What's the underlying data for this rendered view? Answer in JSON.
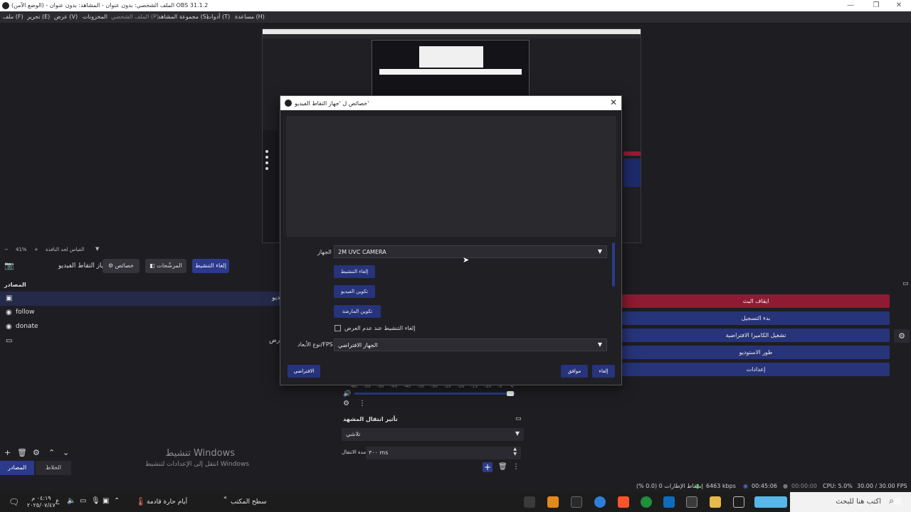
{
  "window": {
    "title": "(الوضع الآمن) - الملف الشخصي: بدون عنوان - المشاهد: بدون عنوان OBS 31.1.2"
  },
  "menu": [
    "ملف (F)",
    "تحرير (E)",
    "عرض (V)",
    "المخزونات",
    "الملف الشخصي (P)",
    "مجموعة المشاهد (S)",
    "أدوات (T)",
    "مساعدة (H)"
  ],
  "preview": {
    "zoom": "41%",
    "fit_label": "القياس لحد النافذة"
  },
  "source_toolbar": {
    "selected_source": "جهاز التقاط الفيديو",
    "properties": "خصائص",
    "filters": "المرشّحات",
    "deactivate": "إلغاء التنشيط"
  },
  "sources": {
    "title": "المصادر",
    "items": [
      {
        "icon": "camera-icon",
        "label": ""
      },
      {
        "icon": "globe-icon",
        "label": "follow"
      },
      {
        "icon": "globe-icon",
        "label": "donate"
      },
      {
        "icon": "display-icon",
        "label": ""
      }
    ],
    "partial_labels": [
      "يديو",
      "رض"
    ]
  },
  "controls": {
    "stop_stream": "ايقاف البث",
    "start_recording": "بدء التسجيل",
    "start_virtual_cam": "تشغيل الكاميرا الافتراضية",
    "studio_mode": "طور الاستوديو",
    "settings": "إعدادات"
  },
  "mixer": {
    "ticks": [
      "-60",
      "-55",
      "-50",
      "-45",
      "-40",
      "-35",
      "-30",
      "-25",
      "-20",
      "-15",
      "-10",
      "-5",
      "0"
    ]
  },
  "transition": {
    "title": "تأثير انتقال المشهد",
    "type": "تلاشي",
    "duration_label": "مدة الانتقال",
    "duration_value": "٣٠٠ ms"
  },
  "watermark": {
    "line1": "تنشيط Windows",
    "line2": "انتقل إلى الإعدادات لتنشيط Windows"
  },
  "dock_tabs": {
    "sources": "المصادر",
    "mixer": "الخلاط"
  },
  "status": {
    "dropped": "إسقاط الإطارات 0 (0.0 %)",
    "bitrate": "6463 kbps",
    "stream_time": "00:45:06",
    "rec_time": "00:00:00",
    "cpu": "CPU: 5.0%",
    "fps": "30.00 / 30.00 FPS"
  },
  "taskbar": {
    "search_placeholder": "اكتب هنا للبحث",
    "desktop": "سطح المكتب",
    "weather": "أيام حارة قادمة",
    "time": "٠٤:١٩ م",
    "date": "٢٠٢٥/٠٧/٤٧",
    "lang": "ع"
  },
  "dialog": {
    "title": "خصائص ل 'جهاز التقاط الفيديو'",
    "device_label": "الجهاز",
    "device_value": "2M UVC CAMERA",
    "deactivate_button": "إلغاء التنشيط",
    "configure_video": "تكوين الفيديو",
    "configure_crossbar": "تكوين المارضة",
    "deactivate_when_hidden": "إلغاء التنشيط عند عدم العرض",
    "resolution_label": "نوع الأبعاد/FPS",
    "resolution_value": "الجهاز الافتراضي",
    "defaults": "الافتراضي",
    "ok": "موافق",
    "cancel": "إلغاء"
  },
  "colors": {
    "accent_blue": "#2c3a8c",
    "danger_red": "#8f1a33",
    "bg": "#1e1e22"
  }
}
